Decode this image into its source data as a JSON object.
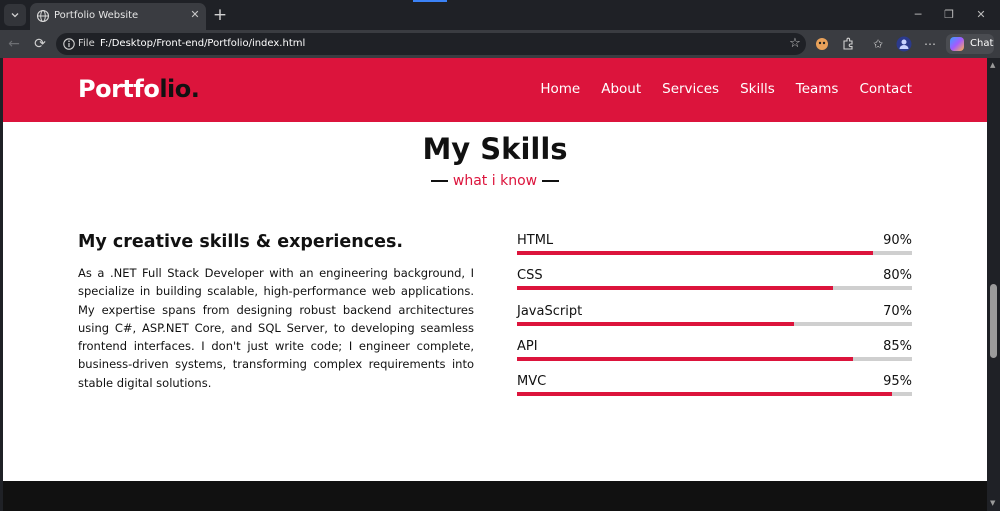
{
  "browser": {
    "tab": {
      "title": "Portfolio Website"
    },
    "address": {
      "label": "File",
      "url": "F:/Desktop/Front-end/Portfolio/index.html"
    },
    "chat_label": "Chat"
  },
  "site": {
    "logo": {
      "main": "Portfo",
      "accent": "lio."
    },
    "nav": [
      "Home",
      "About",
      "Services",
      "Skills",
      "Teams",
      "Contact"
    ]
  },
  "skills": {
    "title": "My Skills",
    "subtitle": "what i know",
    "heading": "My creative skills & experiences.",
    "paragraph": "As a .NET Full Stack Developer with an engineering background, I specialize in building scalable, high-performance web applications. My expertise spans from designing robust backend architectures using C#, ASP.NET Core, and SQL Server, to developing seamless frontend interfaces. I don't just write code; I engineer complete, business-driven systems, transforming complex requirements into stable digital solutions.",
    "items": [
      {
        "name": "HTML",
        "percent_label": "90%",
        "level": 0.9
      },
      {
        "name": "CSS",
        "percent_label": "80%",
        "level": 0.8
      },
      {
        "name": "JavaScript",
        "percent_label": "70%",
        "level": 0.7
      },
      {
        "name": "API",
        "percent_label": "85%",
        "level": 0.85
      },
      {
        "name": "MVC",
        "percent_label": "95%",
        "level": 0.95
      }
    ]
  },
  "colors": {
    "accent": "#dc143c",
    "text": "#111111",
    "track": "#cfcfcf"
  }
}
